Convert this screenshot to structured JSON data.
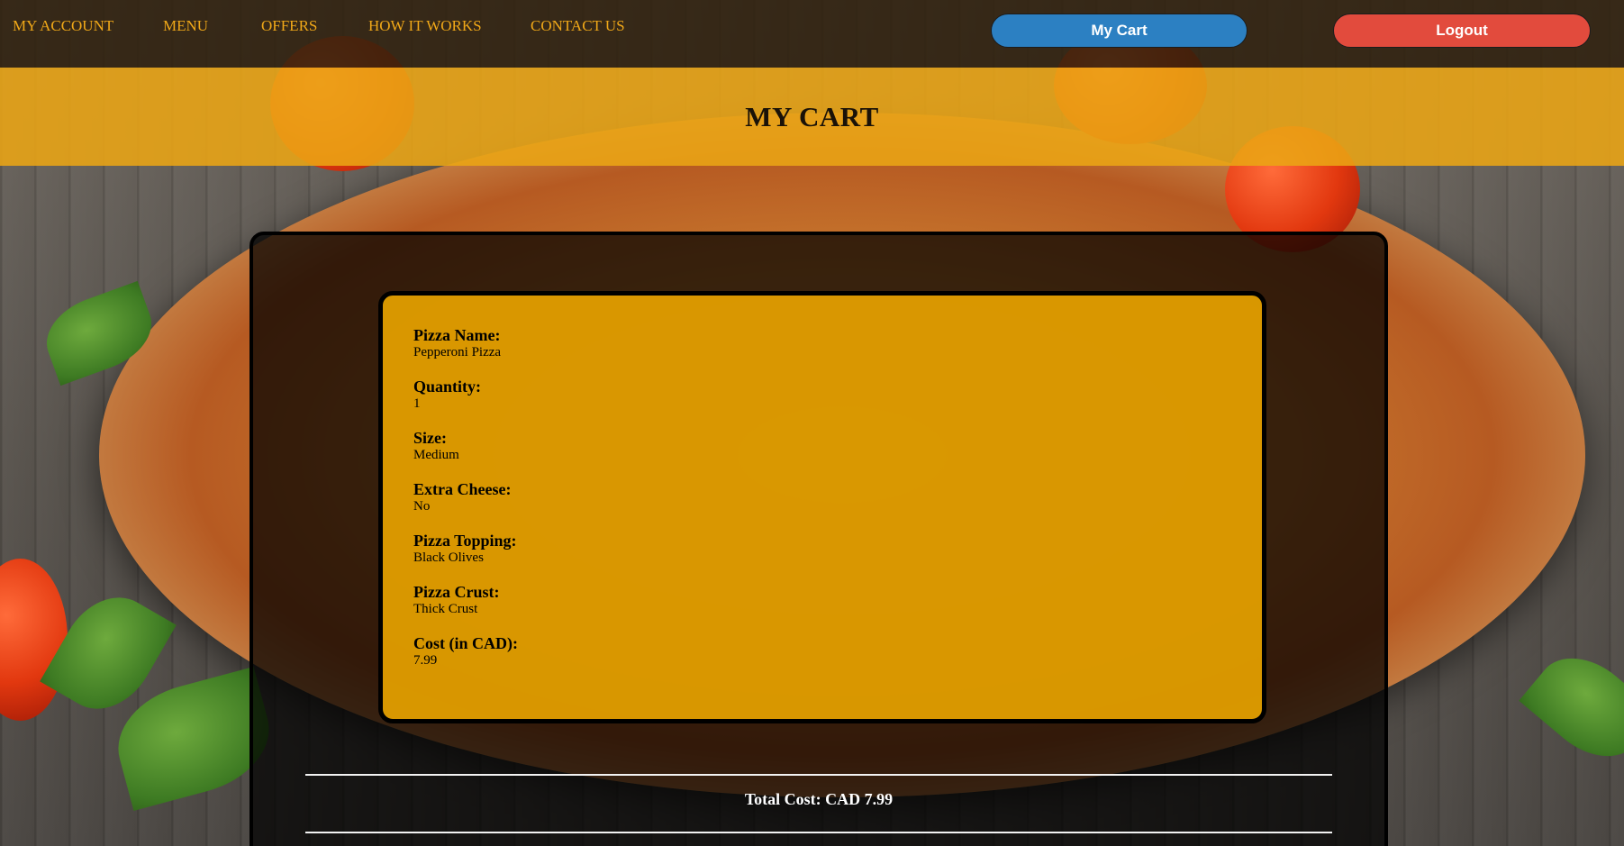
{
  "nav": {
    "links": [
      "MY ACCOUNT",
      "MENU",
      "OFFERS",
      "HOW IT WORKS",
      "CONTACT US"
    ],
    "cart_button": "My Cart",
    "logout_button": "Logout"
  },
  "page_title": "MY CART",
  "cart_item": {
    "fields": [
      {
        "label": "Pizza Name:",
        "value": "Pepperoni Pizza"
      },
      {
        "label": "Quantity:",
        "value": "1"
      },
      {
        "label": "Size:",
        "value": "Medium"
      },
      {
        "label": "Extra Cheese:",
        "value": "No"
      },
      {
        "label": "Pizza Topping:",
        "value": "Black Olives"
      },
      {
        "label": "Pizza Crust:",
        "value": "Thick Crust"
      },
      {
        "label": "Cost (in CAD):",
        "value": "7.99"
      }
    ]
  },
  "total": "Total Cost: CAD 7.99",
  "colors": {
    "nav_link": "#f0a818",
    "cart_button": "#2c80c2",
    "logout_button": "#e24b3d",
    "banner": "#eaa514",
    "card": "#e5a000"
  }
}
